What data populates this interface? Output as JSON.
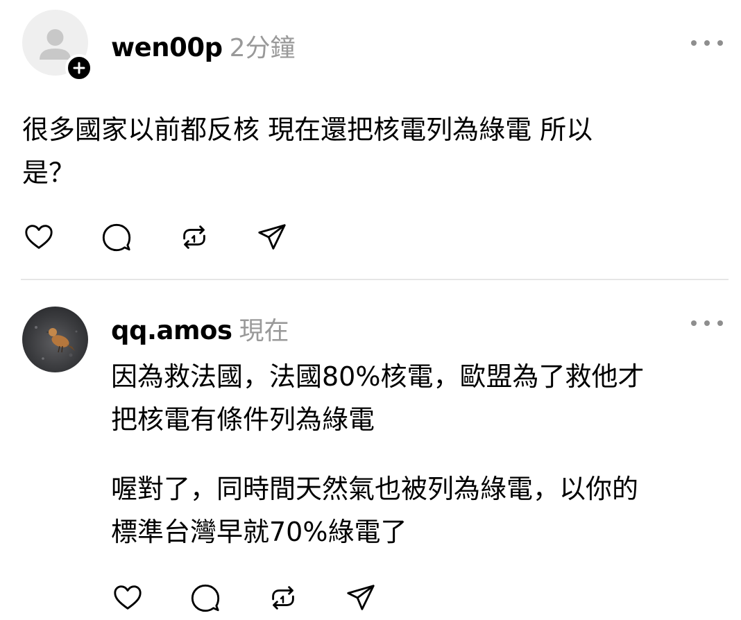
{
  "post1": {
    "username": "wen00p",
    "time": "2分鐘",
    "text_line1": "很多國家以前都反核 現在還把核電列為綠電 所以",
    "text_line2": "是？",
    "avatar_icon": "default-user-avatar-icon",
    "follow_icon": "plus-icon"
  },
  "post2": {
    "username": "qq.amos",
    "time": "現在",
    "avatar_icon": "bird-photo-avatar",
    "para1_line1": "因為救法國，法國80%核電，歐盟為了救他才",
    "para1_line2": "把核電有條件列為綠電",
    "para2_line1": "喔對了，同時間天然氣也被列為綠電，以你的",
    "para2_line2": "標準台灣早就70%綠電了"
  },
  "actions": {
    "icons": [
      "heart-icon",
      "comment-icon",
      "repost-icon",
      "share-icon"
    ]
  },
  "colors": {
    "text": "#000000",
    "muted": "#999999",
    "divider": "#e6e6e6",
    "icon": "#000000"
  }
}
